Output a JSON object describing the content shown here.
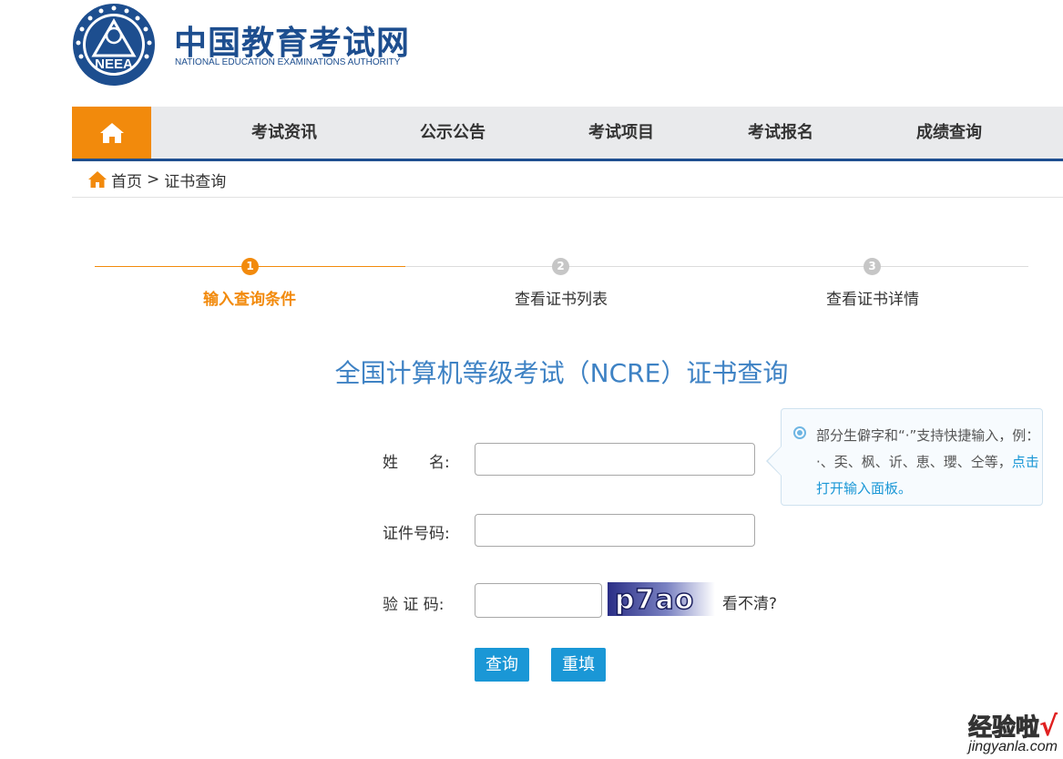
{
  "header": {
    "brand_cn": "中国教育考试网",
    "brand_en": "NATIONAL EDUCATION EXAMINATIONS AUTHORITY",
    "emblem_text": "NEEA"
  },
  "nav": {
    "home_icon": "home-icon",
    "items": [
      {
        "label": "考试资讯"
      },
      {
        "label": "公示公告"
      },
      {
        "label": "考试项目"
      },
      {
        "label": "考试报名"
      },
      {
        "label": "成绩查询"
      }
    ]
  },
  "breadcrumb": {
    "home": "首页",
    "separator": ">",
    "current": "证书查询"
  },
  "steps": [
    {
      "number": "1",
      "label": "输入查询条件",
      "active": true
    },
    {
      "number": "2",
      "label": "查看证书列表",
      "active": false
    },
    {
      "number": "3",
      "label": "查看证书详情",
      "active": false
    }
  ],
  "form": {
    "title": "全国计算机等级考试（NCRE）证书查询",
    "name_label": "姓　　名:",
    "name_value": "",
    "id_label": "证件号码:",
    "id_value": "",
    "captcha_label": "验 证 码:",
    "captcha_value": "",
    "captcha_image_text": "p7ao",
    "captcha_refresh": "看不清?",
    "submit_label": "查询",
    "reset_label": "重填"
  },
  "tip": {
    "text": "部分生僻字和“·”支持快捷输入，例：·、奀、枫、䜣、恵、瓔、仝等，",
    "link": "点击打开输入面板。"
  },
  "watermark": {
    "cn": "经验啦",
    "check": "√",
    "en": "jingyanla.com"
  },
  "colors": {
    "accent_orange": "#f28a0c",
    "nav_blue": "#1e4f90",
    "title_blue": "#3e82c4",
    "button_blue": "#1a97d6",
    "inactive_gray": "#c6c6c6"
  }
}
